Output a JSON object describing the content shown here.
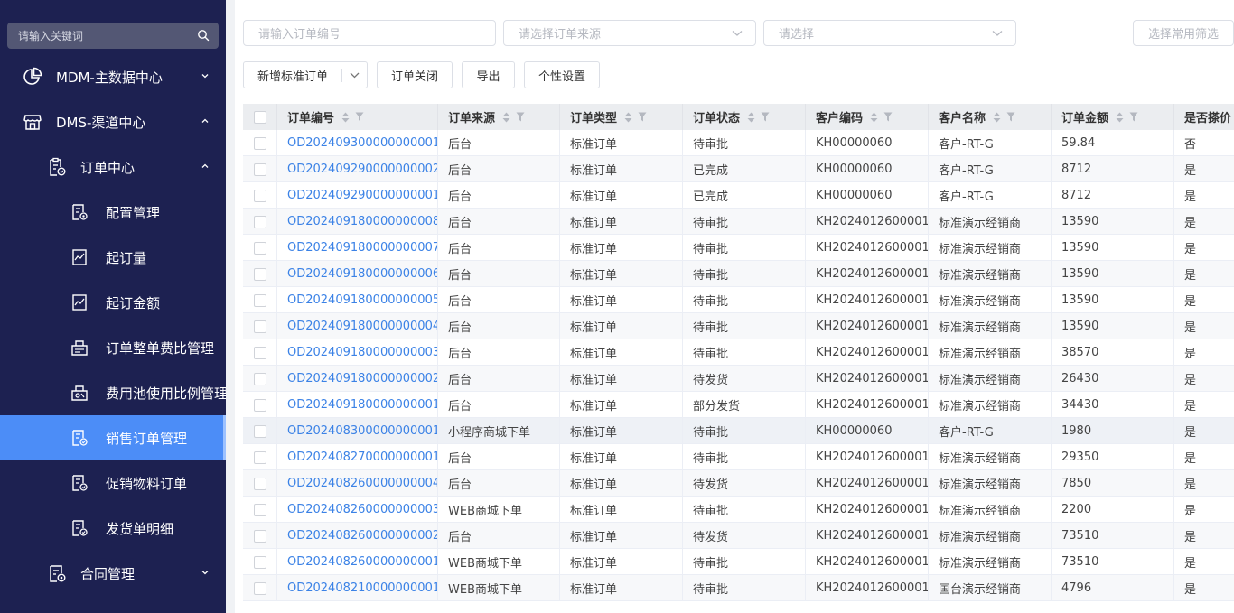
{
  "sidebar": {
    "search_placeholder": "请输入关键词",
    "menu": [
      {
        "label": "MDM-主数据中心",
        "icon": "pie-chart-icon",
        "level": 1,
        "expanded": false
      },
      {
        "label": "DMS-渠道中心",
        "icon": "store-icon",
        "level": 1,
        "expanded": true
      },
      {
        "label": "订单中心",
        "icon": "order-doc-icon",
        "level": 2,
        "expanded": true
      },
      {
        "label": "配置管理",
        "icon": "config-doc-icon",
        "level": 3
      },
      {
        "label": "起订量",
        "icon": "chart-doc-icon",
        "level": 3
      },
      {
        "label": "起订金额",
        "icon": "chart-doc-icon",
        "level": 3
      },
      {
        "label": "订单整单费比管理",
        "icon": "ratio-doc-icon",
        "level": 3
      },
      {
        "label": "费用池使用比例管理",
        "icon": "pool-doc-icon",
        "level": 3
      },
      {
        "label": "销售订单管理",
        "icon": "order-doc-icon",
        "level": 3,
        "active": true
      },
      {
        "label": "促销物料订单",
        "icon": "order-doc-icon",
        "level": 3
      },
      {
        "label": "发货单明细",
        "icon": "order-doc-icon",
        "level": 3
      },
      {
        "label": "合同管理",
        "icon": "contract-doc-icon",
        "level": 2,
        "expanded": false
      }
    ]
  },
  "filters": {
    "order_no_placeholder": "请输入订单编号",
    "source_placeholder": "请选择订单来源",
    "status_placeholder": "请选择",
    "common_filter_placeholder": "选择常用筛选"
  },
  "toolbar": {
    "new_label": "新增标准订单",
    "close_label": "订单关闭",
    "export_label": "导出",
    "personal_label": "个性设置"
  },
  "table": {
    "columns": [
      "订单编号",
      "订单来源",
      "订单类型",
      "订单状态",
      "客户编码",
      "客户名称",
      "订单金额",
      "是否搽价"
    ],
    "rows": [
      [
        "OD202409300000000001",
        "后台",
        "标准订单",
        "待审批",
        "KH00000060",
        "客户-RT-G",
        "59.84",
        "否"
      ],
      [
        "OD202409290000000002",
        "后台",
        "标准订单",
        "已完成",
        "KH00000060",
        "客户-RT-G",
        "8712",
        "是"
      ],
      [
        "OD202409290000000001",
        "后台",
        "标准订单",
        "已完成",
        "KH00000060",
        "客户-RT-G",
        "8712",
        "是"
      ],
      [
        "OD202409180000000008",
        "后台",
        "标准订单",
        "待审批",
        "KH2024012600001",
        "标准演示经销商",
        "13590",
        "是"
      ],
      [
        "OD202409180000000007",
        "后台",
        "标准订单",
        "待审批",
        "KH2024012600001",
        "标准演示经销商",
        "13590",
        "是"
      ],
      [
        "OD202409180000000006",
        "后台",
        "标准订单",
        "待审批",
        "KH2024012600001",
        "标准演示经销商",
        "13590",
        "是"
      ],
      [
        "OD202409180000000005",
        "后台",
        "标准订单",
        "待审批",
        "KH2024012600001",
        "标准演示经销商",
        "13590",
        "是"
      ],
      [
        "OD202409180000000004",
        "后台",
        "标准订单",
        "待审批",
        "KH2024012600001",
        "标准演示经销商",
        "13590",
        "是"
      ],
      [
        "OD202409180000000003",
        "后台",
        "标准订单",
        "待审批",
        "KH2024012600001",
        "标准演示经销商",
        "38570",
        "是"
      ],
      [
        "OD202409180000000002",
        "后台",
        "标准订单",
        "待发货",
        "KH2024012600001",
        "标准演示经销商",
        "26430",
        "是"
      ],
      [
        "OD202409180000000001",
        "后台",
        "标准订单",
        "部分发货",
        "KH2024012600001",
        "标准演示经销商",
        "34430",
        "是"
      ],
      [
        "OD202408300000000001",
        "小程序商城下单",
        "标准订单",
        "待审批",
        "KH00000060",
        "客户-RT-G",
        "1980",
        "是"
      ],
      [
        "OD202408270000000001",
        "后台",
        "标准订单",
        "待审批",
        "KH2024012600001",
        "标准演示经销商",
        "29350",
        "是"
      ],
      [
        "OD202408260000000004",
        "后台",
        "标准订单",
        "待发货",
        "KH2024012600001",
        "标准演示经销商",
        "7850",
        "是"
      ],
      [
        "OD202408260000000003",
        "WEB商城下单",
        "标准订单",
        "待审批",
        "KH2024012600001",
        "标准演示经销商",
        "2200",
        "是"
      ],
      [
        "OD202408260000000002",
        "后台",
        "标准订单",
        "待发货",
        "KH2024012600001",
        "标准演示经销商",
        "73510",
        "是"
      ],
      [
        "OD202408260000000001",
        "WEB商城下单",
        "标准订单",
        "待审批",
        "KH2024012600001",
        "标准演示经销商",
        "73510",
        "是"
      ],
      [
        "OD202408210000000001",
        "WEB商城下单",
        "标准订单",
        "待审批",
        "KH2024012600001",
        "国台演示经销商",
        "4796",
        "是"
      ]
    ]
  },
  "colors": {
    "sidebar_bg": "#1d2151",
    "active_bg": "#4c8df7",
    "link": "#3b82e6"
  }
}
